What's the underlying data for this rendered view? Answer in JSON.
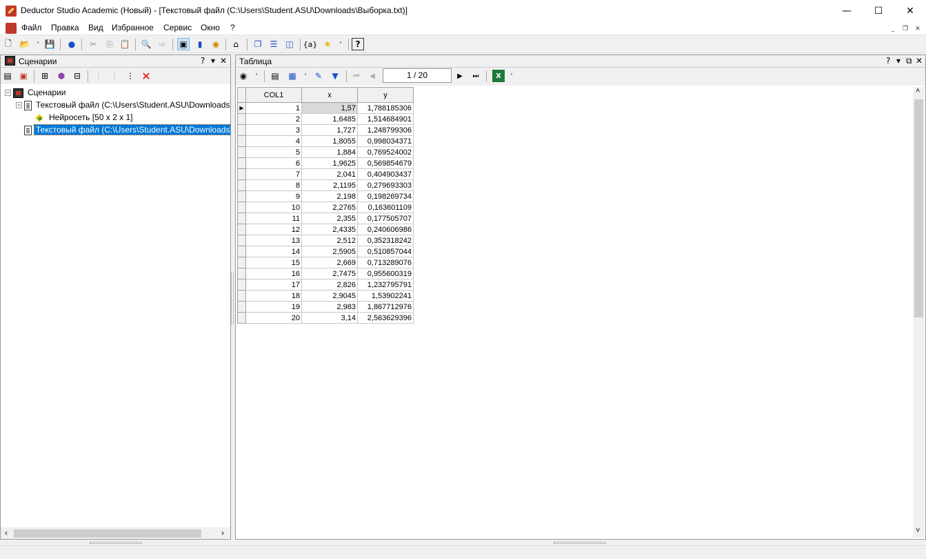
{
  "window": {
    "title": "Deductor Studio Academic (Новый) - [Текстовый файл (C:\\Users\\Student.ASU\\Downloads\\Выборка.txt)]",
    "min": "—",
    "max": "☐",
    "close": "✕"
  },
  "menu": [
    "Файл",
    "Правка",
    "Вид",
    "Избранное",
    "Сервис",
    "Окно",
    "?"
  ],
  "mdi": {
    "min": "_",
    "restore": "❐",
    "close": "✕"
  },
  "left_panel": {
    "title": "Сценарии",
    "help": "?",
    "pin": "▾",
    "close": "✕",
    "tree": {
      "root": "Сценарии",
      "node1": "Текстовый файл (C:\\Users\\Student.ASU\\Downloads\\Cre",
      "node1_child": "Нейросеть [50 x 2 x 1]",
      "node2": "Текстовый файл (C:\\Users\\Student.ASU\\Downloads\\Вы"
    }
  },
  "right_panel": {
    "title": "Таблица",
    "help": "?",
    "pin": "▾",
    "float": "⧉",
    "close": "✕",
    "pager": "1 / 20"
  },
  "table": {
    "headers": [
      "COL1",
      "x",
      "y"
    ],
    "rows": [
      [
        "1",
        "1,57",
        "1,788185306"
      ],
      [
        "2",
        "1,6485",
        "1,514684901"
      ],
      [
        "3",
        "1,727",
        "1,248799306"
      ],
      [
        "4",
        "1,8055",
        "0,998034371"
      ],
      [
        "5",
        "1,884",
        "0,769524002"
      ],
      [
        "6",
        "1,9625",
        "0,569854679"
      ],
      [
        "7",
        "2,041",
        "0,404903437"
      ],
      [
        "8",
        "2,1195",
        "0,279693303"
      ],
      [
        "9",
        "2,198",
        "0,198269734"
      ],
      [
        "10",
        "2,2765",
        "0,163601109"
      ],
      [
        "11",
        "2,355",
        "0,177505707"
      ],
      [
        "12",
        "2,4335",
        "0,240606986"
      ],
      [
        "13",
        "2,512",
        "0,352318242"
      ],
      [
        "14",
        "2,5905",
        "0,510857044"
      ],
      [
        "15",
        "2,669",
        "0,713289076"
      ],
      [
        "16",
        "2,7475",
        "0,955600319"
      ],
      [
        "17",
        "2,826",
        "1,232795791"
      ],
      [
        "18",
        "2,9045",
        "1,53902241"
      ],
      [
        "19",
        "2,983",
        "1,867712976"
      ],
      [
        "20",
        "3,14",
        "2,563629396"
      ]
    ]
  },
  "icons": {
    "new": "🗋",
    "open": "📂",
    "save": "💾",
    "find": "🔍",
    "home": "⌂",
    "star": "★",
    "help": "?",
    "filter": "▼",
    "excel": "X",
    "first": "⏮",
    "prev": "◀",
    "next": "▶",
    "last": "⏭",
    "delete": "✕",
    "left": "‹",
    "right": "›",
    "up": "˄",
    "down": "˅",
    "current_row": "▶"
  }
}
